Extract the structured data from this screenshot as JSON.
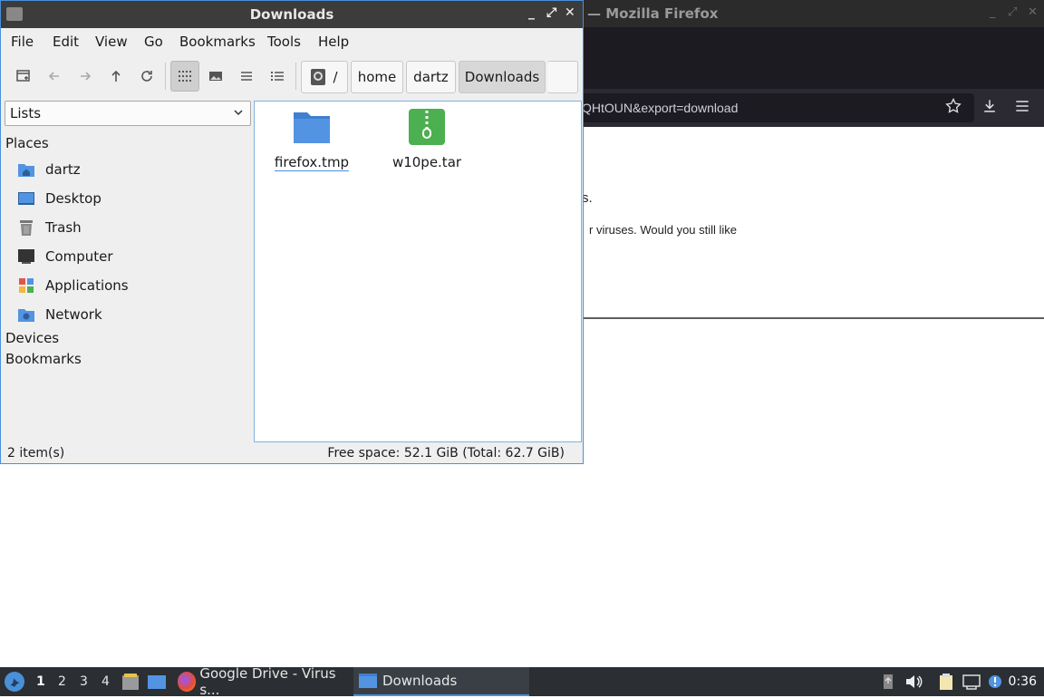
{
  "firefox": {
    "title": "— Mozilla Firefox",
    "url_fragment": "QHtOUN&export=download",
    "content_line1": "s.",
    "content_line2": "r viruses. Would you still like"
  },
  "file_manager": {
    "title": "Downloads",
    "menu": [
      "File",
      "Edit",
      "View",
      "Go",
      "Bookmarks",
      "Tools",
      "Help"
    ],
    "breadcrumbs": [
      "/",
      "home",
      "dartz",
      "Downloads"
    ],
    "side_pane_mode": "Lists",
    "sidebar": {
      "places_heading": "Places",
      "places": [
        {
          "label": "dartz",
          "icon": "home-folder-icon"
        },
        {
          "label": "Desktop",
          "icon": "desktop-icon"
        },
        {
          "label": "Trash",
          "icon": "trash-icon"
        },
        {
          "label": "Computer",
          "icon": "computer-icon"
        },
        {
          "label": "Applications",
          "icon": "applications-icon"
        },
        {
          "label": "Network",
          "icon": "network-icon"
        }
      ],
      "devices_heading": "Devices",
      "bookmarks_heading": "Bookmarks"
    },
    "files": [
      {
        "name": "firefox.tmp",
        "icon": "folder-icon"
      },
      {
        "name": "w10pe.tar",
        "icon": "archive-icon"
      }
    ],
    "status": {
      "count": "2 item(s)",
      "space": "Free space: 52.1 GiB (Total: 62.7 GiB)"
    }
  },
  "taskbar": {
    "workspaces": [
      "1",
      "2",
      "3",
      "4"
    ],
    "active_workspace": "1",
    "tasks": [
      {
        "label": "Google Drive - Virus s...",
        "icon": "firefox-icon"
      },
      {
        "label": "Downloads",
        "icon": "folder-icon"
      }
    ],
    "clock": "0:36"
  },
  "colors": {
    "accent": "#4a90d9",
    "folder_blue": "#5294e2",
    "archive_green": "#4caf50"
  }
}
